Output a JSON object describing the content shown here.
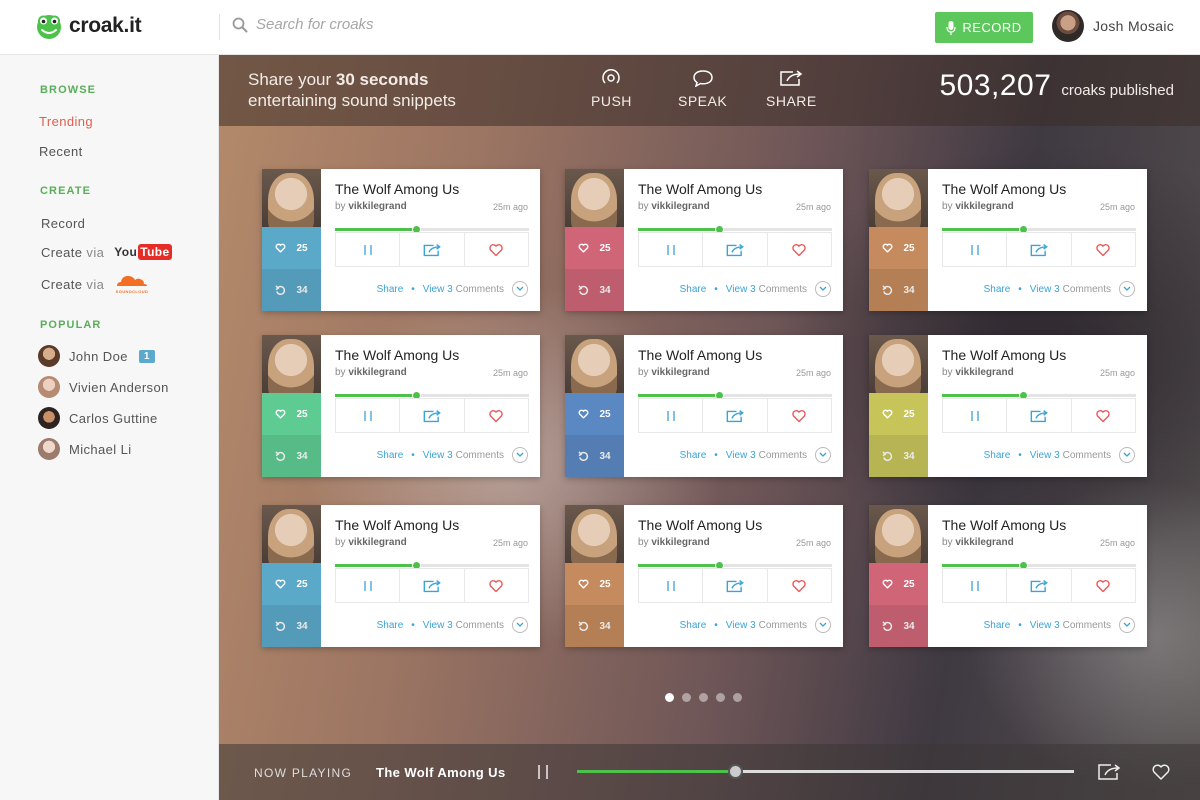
{
  "app": {
    "name": "croak.it"
  },
  "search": {
    "placeholder": "Search for croaks"
  },
  "record_button": {
    "label": "RECORD"
  },
  "user": {
    "name": "Josh Mosaic"
  },
  "sidebar": {
    "browse_heading": "BROWSE",
    "browse": [
      {
        "label": "Trending",
        "active": true
      },
      {
        "label": "Recent",
        "active": false
      }
    ],
    "create_heading": "CREATE",
    "create": [
      {
        "label": "Record"
      },
      {
        "label": "Create",
        "via": "via",
        "service": "YouTube"
      },
      {
        "label": "Create",
        "via": "via",
        "service": "SoundCloud"
      }
    ],
    "youtube": {
      "you": "You",
      "tube": "Tube"
    },
    "soundcloud_label": "SOUNDCLOUD",
    "popular_heading": "POPULAR",
    "popular": [
      {
        "name": "John Doe",
        "badge": "1"
      },
      {
        "name": "Vivien Anderson"
      },
      {
        "name": "Carlos Guttine"
      },
      {
        "name": "Michael Li"
      }
    ]
  },
  "hero": {
    "text_prefix": "Share your ",
    "text_bold": "30 seconds",
    "text_line2": "entertaining sound snippets",
    "steps": [
      {
        "label": "PUSH",
        "icon": "push-icon"
      },
      {
        "label": "SPEAK",
        "icon": "speech-bubble-icon"
      },
      {
        "label": "SHARE",
        "icon": "share-icon"
      }
    ],
    "counter_value": "503,207",
    "counter_label": "croaks published"
  },
  "card_template": {
    "title": "The Wolf Among Us",
    "by": "by",
    "author": "vikkilegrand",
    "time": "25m ago",
    "likes": "25",
    "replays": "34",
    "progress": 0.42,
    "share_link": "Share",
    "view_link": "View 3",
    "comments_label": "Comments"
  },
  "cards": [
    {
      "color": "#5ba9c9"
    },
    {
      "color": "#cf6577"
    },
    {
      "color": "#c58a5e"
    },
    {
      "color": "#5dcb92"
    },
    {
      "color": "#5a88c3"
    },
    {
      "color": "#c7c55a"
    },
    {
      "color": "#5ba9c9"
    },
    {
      "color": "#c58a5e"
    },
    {
      "color": "#cf6577"
    }
  ],
  "pager": {
    "pages": 5,
    "current": 1
  },
  "now_playing": {
    "label": "NOW PLAYING",
    "title": "The Wolf Among Us",
    "progress": 0.32
  },
  "colors": {
    "accent_green": "#5cc75a",
    "link_blue": "#3aa3d8",
    "trending_red": "#e0604e"
  }
}
